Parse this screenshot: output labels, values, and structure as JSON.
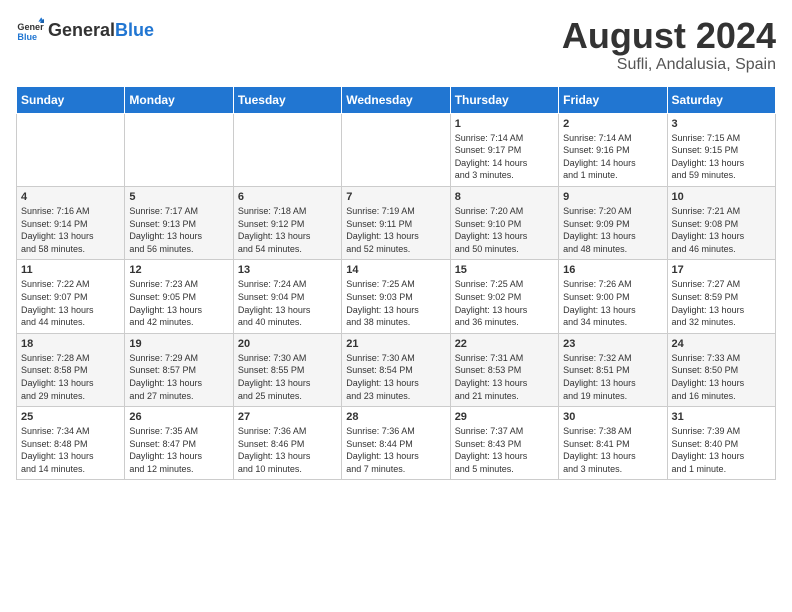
{
  "header": {
    "logo_general": "General",
    "logo_blue": "Blue",
    "month_year": "August 2024",
    "location": "Sufli, Andalusia, Spain"
  },
  "weekdays": [
    "Sunday",
    "Monday",
    "Tuesday",
    "Wednesday",
    "Thursday",
    "Friday",
    "Saturday"
  ],
  "weeks": [
    [
      {
        "day": "",
        "info": ""
      },
      {
        "day": "",
        "info": ""
      },
      {
        "day": "",
        "info": ""
      },
      {
        "day": "",
        "info": ""
      },
      {
        "day": "1",
        "info": "Sunrise: 7:14 AM\nSunset: 9:17 PM\nDaylight: 14 hours\nand 3 minutes."
      },
      {
        "day": "2",
        "info": "Sunrise: 7:14 AM\nSunset: 9:16 PM\nDaylight: 14 hours\nand 1 minute."
      },
      {
        "day": "3",
        "info": "Sunrise: 7:15 AM\nSunset: 9:15 PM\nDaylight: 13 hours\nand 59 minutes."
      }
    ],
    [
      {
        "day": "4",
        "info": "Sunrise: 7:16 AM\nSunset: 9:14 PM\nDaylight: 13 hours\nand 58 minutes."
      },
      {
        "day": "5",
        "info": "Sunrise: 7:17 AM\nSunset: 9:13 PM\nDaylight: 13 hours\nand 56 minutes."
      },
      {
        "day": "6",
        "info": "Sunrise: 7:18 AM\nSunset: 9:12 PM\nDaylight: 13 hours\nand 54 minutes."
      },
      {
        "day": "7",
        "info": "Sunrise: 7:19 AM\nSunset: 9:11 PM\nDaylight: 13 hours\nand 52 minutes."
      },
      {
        "day": "8",
        "info": "Sunrise: 7:20 AM\nSunset: 9:10 PM\nDaylight: 13 hours\nand 50 minutes."
      },
      {
        "day": "9",
        "info": "Sunrise: 7:20 AM\nSunset: 9:09 PM\nDaylight: 13 hours\nand 48 minutes."
      },
      {
        "day": "10",
        "info": "Sunrise: 7:21 AM\nSunset: 9:08 PM\nDaylight: 13 hours\nand 46 minutes."
      }
    ],
    [
      {
        "day": "11",
        "info": "Sunrise: 7:22 AM\nSunset: 9:07 PM\nDaylight: 13 hours\nand 44 minutes."
      },
      {
        "day": "12",
        "info": "Sunrise: 7:23 AM\nSunset: 9:05 PM\nDaylight: 13 hours\nand 42 minutes."
      },
      {
        "day": "13",
        "info": "Sunrise: 7:24 AM\nSunset: 9:04 PM\nDaylight: 13 hours\nand 40 minutes."
      },
      {
        "day": "14",
        "info": "Sunrise: 7:25 AM\nSunset: 9:03 PM\nDaylight: 13 hours\nand 38 minutes."
      },
      {
        "day": "15",
        "info": "Sunrise: 7:25 AM\nSunset: 9:02 PM\nDaylight: 13 hours\nand 36 minutes."
      },
      {
        "day": "16",
        "info": "Sunrise: 7:26 AM\nSunset: 9:00 PM\nDaylight: 13 hours\nand 34 minutes."
      },
      {
        "day": "17",
        "info": "Sunrise: 7:27 AM\nSunset: 8:59 PM\nDaylight: 13 hours\nand 32 minutes."
      }
    ],
    [
      {
        "day": "18",
        "info": "Sunrise: 7:28 AM\nSunset: 8:58 PM\nDaylight: 13 hours\nand 29 minutes."
      },
      {
        "day": "19",
        "info": "Sunrise: 7:29 AM\nSunset: 8:57 PM\nDaylight: 13 hours\nand 27 minutes."
      },
      {
        "day": "20",
        "info": "Sunrise: 7:30 AM\nSunset: 8:55 PM\nDaylight: 13 hours\nand 25 minutes."
      },
      {
        "day": "21",
        "info": "Sunrise: 7:30 AM\nSunset: 8:54 PM\nDaylight: 13 hours\nand 23 minutes."
      },
      {
        "day": "22",
        "info": "Sunrise: 7:31 AM\nSunset: 8:53 PM\nDaylight: 13 hours\nand 21 minutes."
      },
      {
        "day": "23",
        "info": "Sunrise: 7:32 AM\nSunset: 8:51 PM\nDaylight: 13 hours\nand 19 minutes."
      },
      {
        "day": "24",
        "info": "Sunrise: 7:33 AM\nSunset: 8:50 PM\nDaylight: 13 hours\nand 16 minutes."
      }
    ],
    [
      {
        "day": "25",
        "info": "Sunrise: 7:34 AM\nSunset: 8:48 PM\nDaylight: 13 hours\nand 14 minutes."
      },
      {
        "day": "26",
        "info": "Sunrise: 7:35 AM\nSunset: 8:47 PM\nDaylight: 13 hours\nand 12 minutes."
      },
      {
        "day": "27",
        "info": "Sunrise: 7:36 AM\nSunset: 8:46 PM\nDaylight: 13 hours\nand 10 minutes."
      },
      {
        "day": "28",
        "info": "Sunrise: 7:36 AM\nSunset: 8:44 PM\nDaylight: 13 hours\nand 7 minutes."
      },
      {
        "day": "29",
        "info": "Sunrise: 7:37 AM\nSunset: 8:43 PM\nDaylight: 13 hours\nand 5 minutes."
      },
      {
        "day": "30",
        "info": "Sunrise: 7:38 AM\nSunset: 8:41 PM\nDaylight: 13 hours\nand 3 minutes."
      },
      {
        "day": "31",
        "info": "Sunrise: 7:39 AM\nSunset: 8:40 PM\nDaylight: 13 hours\nand 1 minute."
      }
    ]
  ]
}
